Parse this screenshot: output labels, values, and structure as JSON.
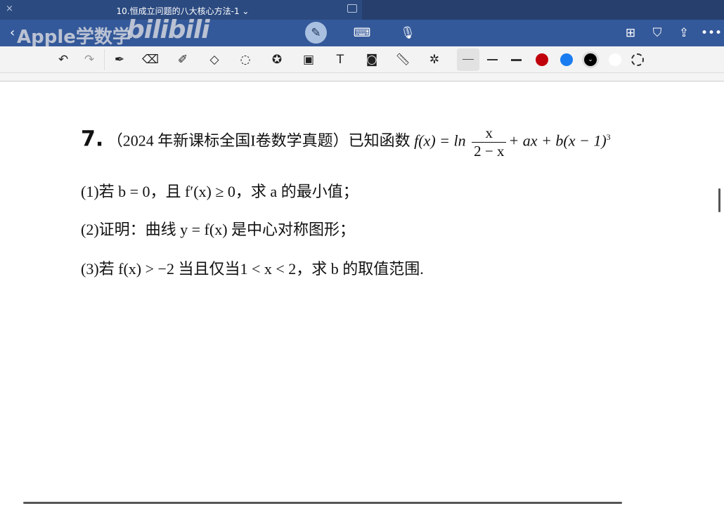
{
  "titlebar": {
    "title": "10.恒成立问题的八大核心方法-1 ⌄",
    "close_icon": "×"
  },
  "watermark": {
    "text": "Apple学数学",
    "logo": "bilibili"
  },
  "navbar": {
    "back": "‹"
  },
  "toolbar": {
    "colors": {
      "red": "#c0000b",
      "blue": "#1a7cf0",
      "black": "#000000",
      "white": "#ffffff"
    }
  },
  "problem": {
    "number": "7.",
    "intro": "（2024 年新课标全国I卷数学真题）已知函数 ",
    "fx": "f(x) = ln",
    "frac_num": "x",
    "frac_den": "2 − x",
    "tail": "+ ax + b(x − 1)",
    "exp": "3",
    "q1": "(1)若 b = 0，且 f′(x) ≥ 0，求 a 的最小值；",
    "q2": "(2)证明：曲线 y = f(x) 是中心对称图形；",
    "q3": "(3)若 f(x) > −2 当且仅当1 < x < 2，求 b 的取值范围."
  }
}
